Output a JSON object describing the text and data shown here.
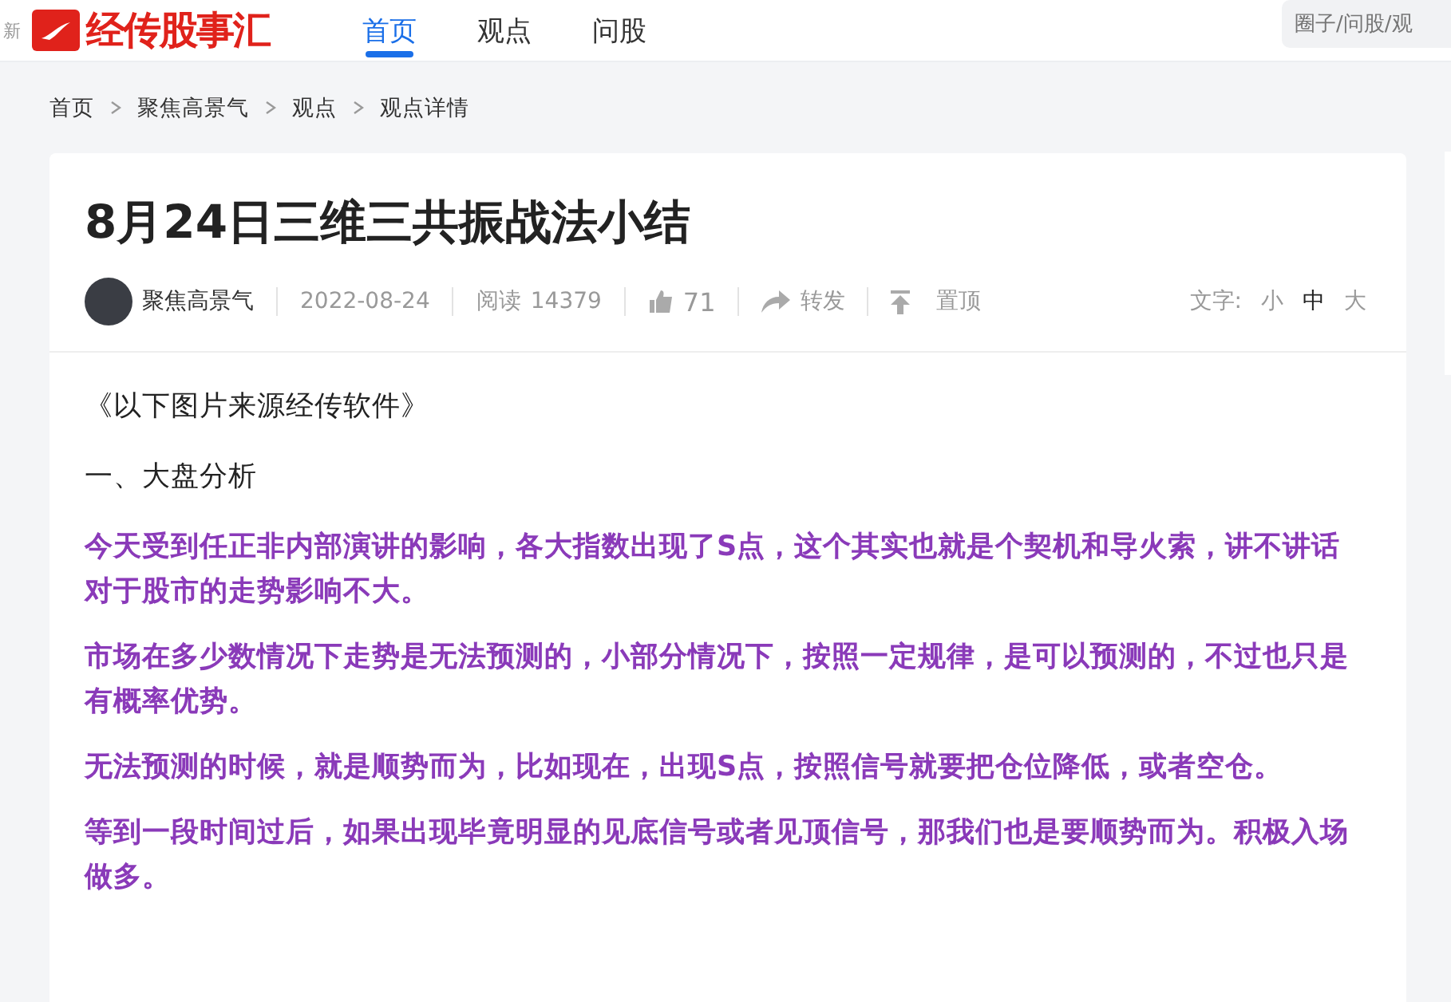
{
  "header": {
    "refresh": "新",
    "logo": "经传股事汇",
    "nav": [
      {
        "label": "首页",
        "selected": true
      },
      {
        "label": "观点",
        "selected": false
      },
      {
        "label": "问股",
        "selected": false
      }
    ],
    "search": {
      "placeholder": "圈子/问股/观"
    }
  },
  "breadcrumb": [
    "首页",
    "聚焦高景气",
    "观点",
    "观点详情"
  ],
  "article": {
    "title": "8月24日三维三共振战法小结",
    "author": "聚焦高景气",
    "date": "2022-08-24",
    "reads_label": "阅读",
    "reads": "14379",
    "likes": "71",
    "share": "转发",
    "pin": "置顶",
    "font_label": "文字:",
    "font_sizes": [
      {
        "label": "小",
        "selected": false
      },
      {
        "label": "中",
        "selected": true
      },
      {
        "label": "大",
        "selected": false
      }
    ],
    "paragraphs": [
      {
        "kind": "plain",
        "text": "《以下图片来源经传软件》"
      },
      {
        "kind": "plain",
        "text": "一、大盘分析"
      },
      {
        "kind": "highlight",
        "text": "今天受到任正非内部演讲的影响，各大指数出现了S点，这个其实也就是个契机和导火索，讲不讲话对于股市的走势影响不大。"
      },
      {
        "kind": "highlight",
        "text": "市场在多少数情况下走势是无法预测的，小部分情况下，按照一定规律，是可以预测的，不过也只是有概率优势。"
      },
      {
        "kind": "highlight",
        "text": "无法预测的时候，就是顺势而为，比如现在，出现S点，按照信号就要把仓位降低，或者空仓。"
      },
      {
        "kind": "highlight",
        "text": "等到一段时间过后，如果出现毕竟明显的见底信号或者见顶信号，那我们也是要顺势而为。积极入场做多。"
      }
    ]
  }
}
